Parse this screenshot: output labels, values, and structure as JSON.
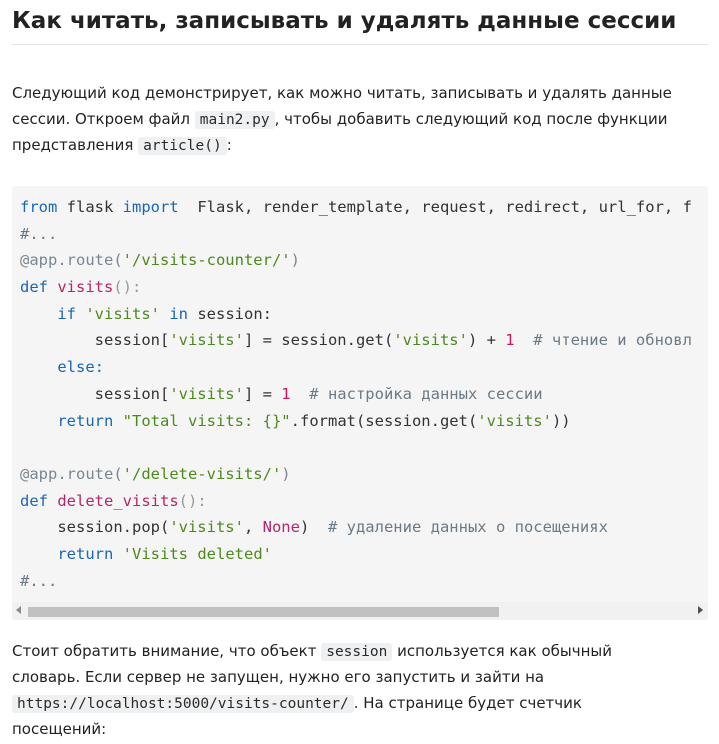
{
  "heading": "Как читать, записывать и удалять данные сессии",
  "intro": {
    "line1": "Следующий код демонстрирует, как можно читать, записывать и удалять данные",
    "line2_a": "сессии. Откроем файл ",
    "line2_code": "main2.py",
    "line2_b": ", чтобы добавить следующий код после функции",
    "line3_a": "представления ",
    "line3_code": "article()",
    "line3_b": ":"
  },
  "code": {
    "l1": {
      "kw1": "from",
      "mod": " flask ",
      "kw2": "import",
      "rest": "  Flask, render_template, request, redirect, url_for, f"
    },
    "l2": "#...",
    "l3": {
      "dec": "@app.route(",
      "str": "'/visits-counter/'",
      "end": ")"
    },
    "l4": {
      "kw": "def",
      "fn": "visits",
      "end": "():"
    },
    "l5": {
      "kw": "if",
      "str": "'visits'",
      "kw2": "in",
      "rest": " session:"
    },
    "l6": {
      "a": "session[",
      "str1": "'visits'",
      "b": "] = session.get(",
      "str2": "'visits'",
      "c": ") + ",
      "num": "1",
      "cm": "  # чтение и обновл"
    },
    "l7": "else:",
    "l8": {
      "a": "session[",
      "str": "'visits'",
      "b": "] = ",
      "num": "1",
      "cm": "  # настройка данных сессии"
    },
    "l9": {
      "kw": "return",
      "str": "\"Total visits: {}\"",
      "b": ".format(session.get(",
      "str2": "'visits'",
      "c": "))"
    },
    "l10": {
      "dec": "@app.route(",
      "str": "'/delete-visits/'",
      "end": ")"
    },
    "l11": {
      "kw": "def",
      "fn": "delete_visits",
      "end": "():"
    },
    "l12": {
      "a": "session.pop(",
      "str": "'visits'",
      "b": ", ",
      "none": "None",
      "c": ")",
      "cm": "  # удаление данных о посещениях"
    },
    "l13": {
      "kw": "return",
      "str": "'Visits deleted'"
    },
    "l14": "#..."
  },
  "outro": {
    "line1_a": "Стоит обратить внимание, что объект ",
    "line1_code": "session",
    "line1_b": " используется как обычный",
    "line2": "словарь. Если сервер не запущен, нужно его запустить и зайти на",
    "line3_code": "https://localhost:5000/visits-counter/",
    "line3_b": ". На странице будет счетчик",
    "line4": "посещений:"
  },
  "colors": {
    "keyword": "#1a66b8",
    "function": "#b4266a",
    "string": "#4d8a1e",
    "comment": "#6b7a86",
    "number": "#c8185e",
    "code_background": "#f5f5f5"
  }
}
